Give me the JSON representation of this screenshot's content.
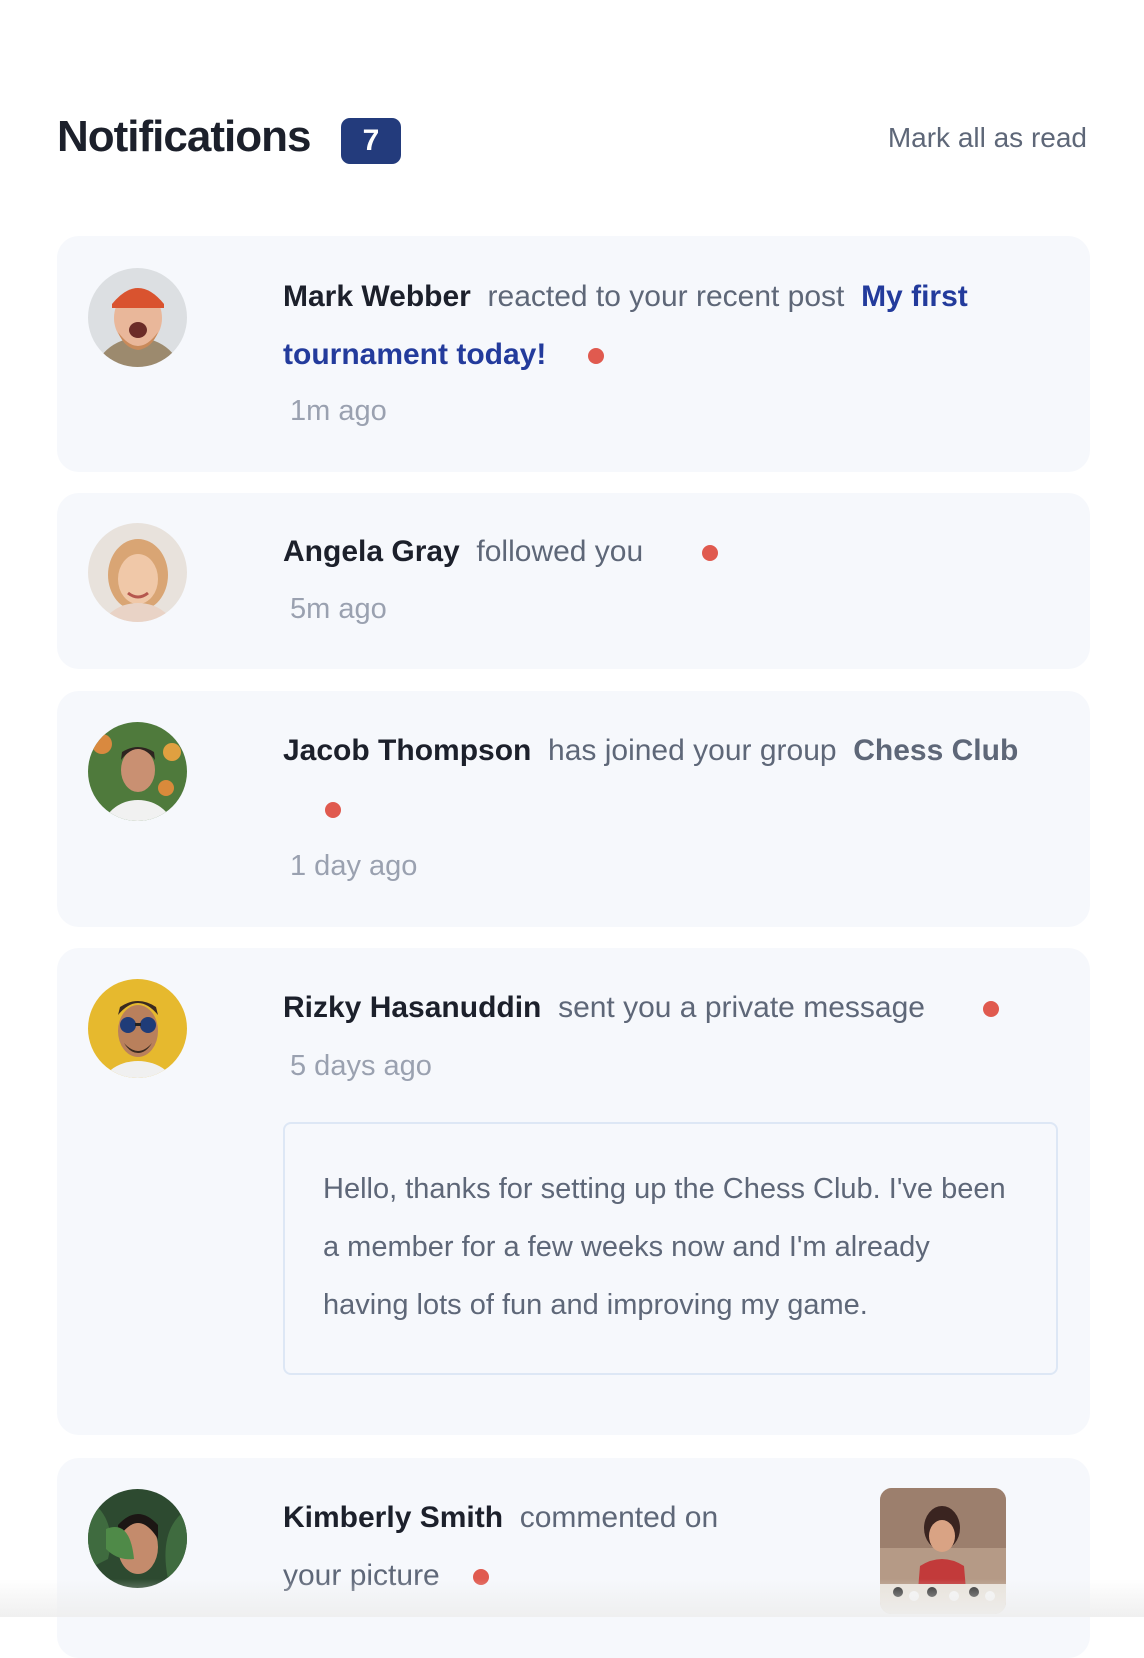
{
  "header": {
    "title": "Notifications",
    "unread_count": "7",
    "mark_all_label": "Mark all as read"
  },
  "notifications": [
    {
      "name": "Mark Webber",
      "action": "reacted to your recent post",
      "target": "My first tournament today!",
      "time": "1m ago",
      "unread": true,
      "avatar_icon": "avatar-mark-webber"
    },
    {
      "name": "Angela Gray",
      "action": "followed you",
      "time": "5m ago",
      "unread": true,
      "avatar_icon": "avatar-angela-gray"
    },
    {
      "name": "Jacob Thompson",
      "action": "has joined your group",
      "target": "Chess Club",
      "time": "1 day ago",
      "unread": true,
      "avatar_icon": "avatar-jacob-thompson"
    },
    {
      "name": "Rizky Hasanuddin",
      "action": "sent you a private message",
      "time": "5 days ago",
      "unread": true,
      "message": "Hello, thanks for setting up the Chess Club. I've been a member for a few weeks now and I'm already having lots of fun and improving my game.",
      "avatar_icon": "avatar-rizky-hasanuddin"
    },
    {
      "name": "Kimberly Smith",
      "action": "commented on your picture",
      "unread": true,
      "avatar_icon": "avatar-kimberly-smith",
      "picture_icon": "chess-picture-thumbnail"
    }
  ],
  "colors": {
    "badge": "#233b7c",
    "unread_dot": "#e05a4f",
    "card_bg": "#f6f8fc",
    "link": "#233b9c"
  }
}
